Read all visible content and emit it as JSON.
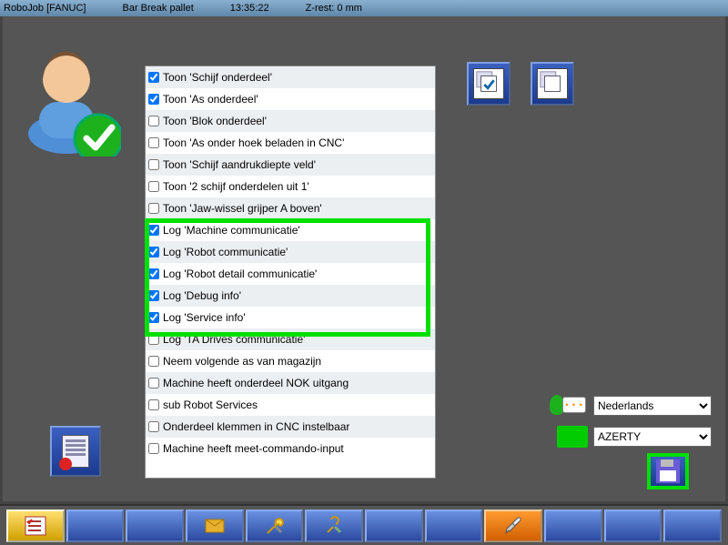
{
  "topbar": {
    "app": "RoboJob [FANUC]",
    "job": "Bar Break pallet",
    "time": "13:35:22",
    "zrest": "Z-rest: 0 mm"
  },
  "options": [
    {
      "label": "Toon 'Schijf onderdeel'",
      "checked": true
    },
    {
      "label": "Toon 'As onderdeel'",
      "checked": true
    },
    {
      "label": "Toon 'Blok onderdeel'",
      "checked": false
    },
    {
      "label": "Toon 'As onder hoek beladen in CNC'",
      "checked": false
    },
    {
      "label": "Toon 'Schijf aandrukdiepte veld'",
      "checked": false
    },
    {
      "label": "Toon '2 schijf onderdelen uit 1'",
      "checked": false
    },
    {
      "label": "Toon 'Jaw-wissel grijper A boven'",
      "checked": false
    },
    {
      "label": "Log 'Machine communicatie'",
      "checked": true
    },
    {
      "label": "Log 'Robot communicatie'",
      "checked": true
    },
    {
      "label": "Log 'Robot detail communicatie'",
      "checked": true
    },
    {
      "label": "Log 'Debug info'",
      "checked": true
    },
    {
      "label": "Log 'Service info'",
      "checked": true
    },
    {
      "label": "Log 'TA Drives communicatie'",
      "checked": false
    },
    {
      "label": "Neem volgende as van magazijn",
      "checked": false
    },
    {
      "label": "Machine heeft onderdeel NOK uitgang",
      "checked": false
    },
    {
      "label": "sub Robot Services",
      "checked": false
    },
    {
      "label": "Onderdeel klemmen in CNC instelbaar",
      "checked": false
    },
    {
      "label": "Machine heeft meet-commando-input",
      "checked": false
    }
  ],
  "language": {
    "selected": "Nederlands"
  },
  "keyboard": {
    "selected": "AZERTY"
  },
  "buttons": {
    "multi_check": "multi-check",
    "multi_blank": "multi-blank",
    "cert": "certificate",
    "save": "save"
  }
}
